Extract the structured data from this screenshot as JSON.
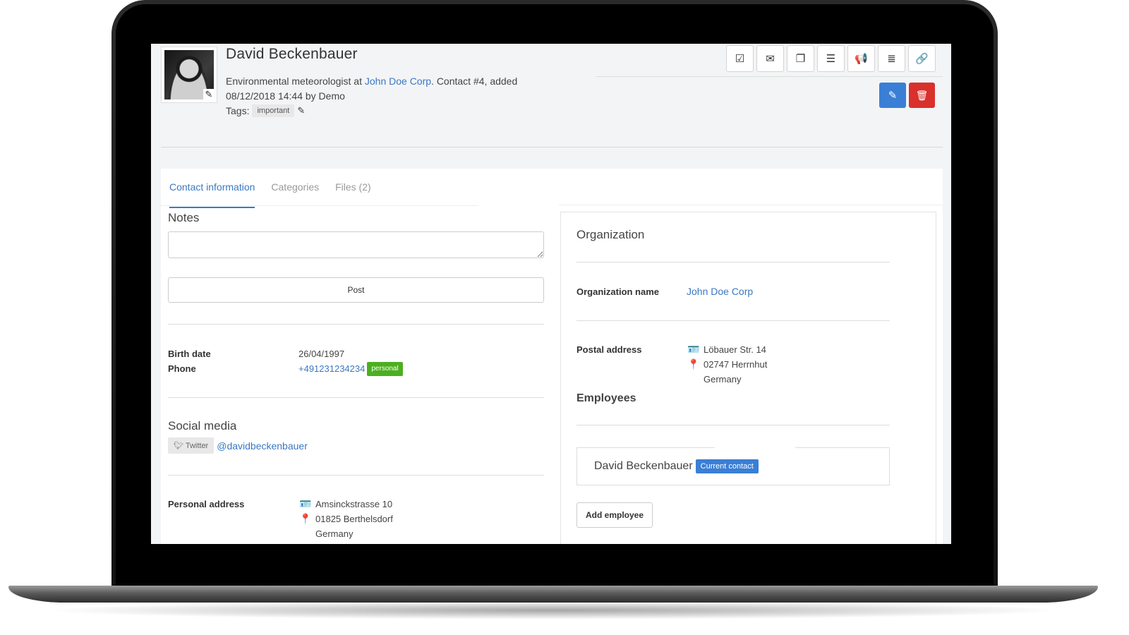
{
  "contact": {
    "name": "David Beckenbauer",
    "job_title": "Environmental meteorologist at ",
    "company": "John Doe Corp",
    "meta": ". Contact #4, added 08/12/2018 14:44 by Demo",
    "tags_label": "Tags:",
    "tag": "important"
  },
  "toolbar": {
    "icons": [
      "check-square-icon",
      "envelope-icon",
      "copy-icon",
      "list-icon",
      "megaphone-icon",
      "database-icon",
      "link-icon"
    ]
  },
  "actions": {
    "edit_icon": "pencil-icon",
    "delete_icon": "trash-icon",
    "edit_color": "#3a7fd5",
    "delete_color": "#d9302c"
  },
  "tabs": [
    {
      "label": "Contact information",
      "active": true
    },
    {
      "label": "Categories",
      "active": false
    },
    {
      "label": "Files (2)",
      "active": false
    }
  ],
  "notes": {
    "title": "Notes",
    "placeholder": "",
    "post_label": "Post"
  },
  "details": {
    "birth_date_label": "Birth date",
    "birth_date": "26/04/1997",
    "phone_label": "Phone",
    "phone": "+491231234234",
    "phone_type": "personal"
  },
  "social": {
    "title": "Social media",
    "network": "Twitter",
    "handle": "@davidbeckenbauer"
  },
  "personal_address": {
    "label": "Personal address",
    "street": "Amsinckstrasse 10",
    "city": "01825 Berthelsdorf",
    "country": "Germany"
  },
  "organization": {
    "title": "Organization",
    "name_label": "Organization name",
    "name": "John Doe Corp",
    "postal_label": "Postal address",
    "street": "Löbauer Str. 14",
    "city": "02747 Herrnhut",
    "country": "Germany",
    "employees_title": "Employees",
    "employee_name": "David Beckenbauer",
    "current_badge": "Current contact",
    "add_employee_label": "Add employee"
  }
}
